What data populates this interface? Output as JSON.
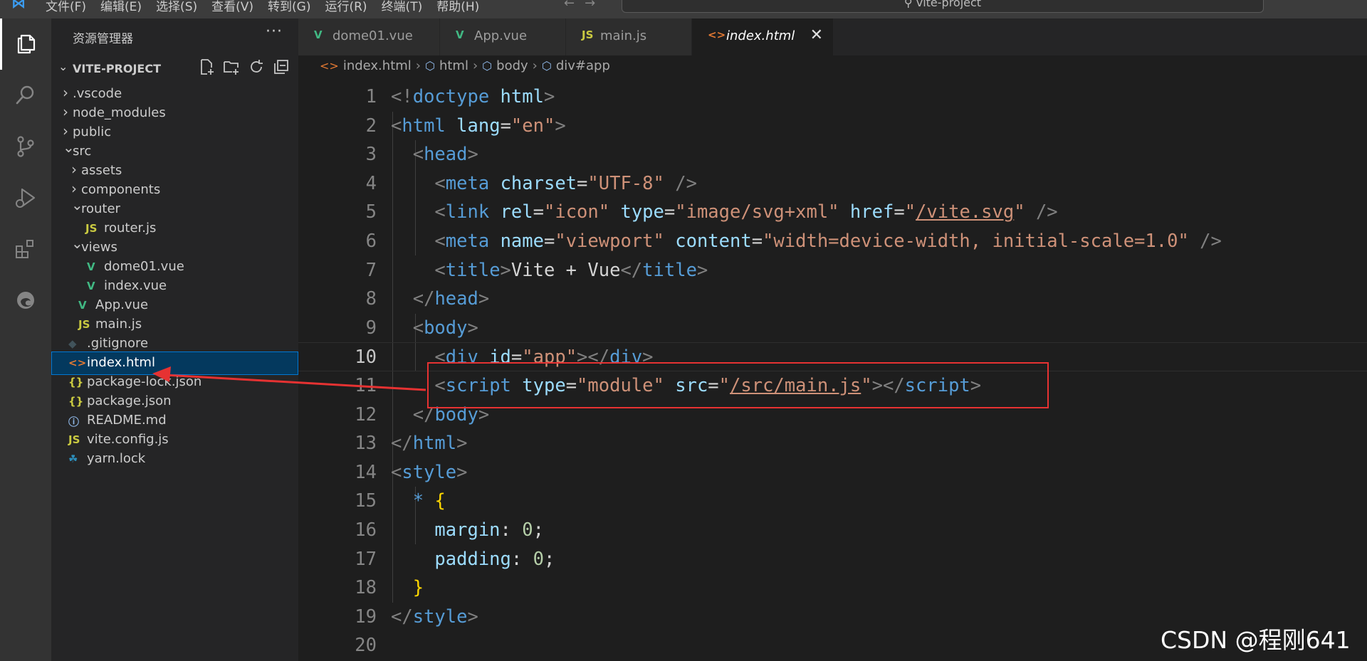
{
  "titlebar": {
    "menu": [
      "文件(F)",
      "编辑(E)",
      "选择(S)",
      "查看(V)",
      "转到(G)",
      "运行(R)",
      "终端(T)",
      "帮助(H)"
    ],
    "search_text": "vite-project"
  },
  "activity_bar": [
    "explorer-icon",
    "search-icon",
    "source-control-icon",
    "run-debug-icon",
    "extensions-icon",
    "edge-tools-icon"
  ],
  "sidebar": {
    "title": "资源管理器",
    "more": "···",
    "project_name": "VITE-PROJECT",
    "tree": [
      {
        "label": ".vscode",
        "type": "folder",
        "expanded": false
      },
      {
        "label": "node_modules",
        "type": "folder",
        "expanded": false
      },
      {
        "label": "public",
        "type": "folder",
        "expanded": false
      },
      {
        "label": "src",
        "type": "folder",
        "expanded": true
      },
      {
        "label": "assets",
        "type": "folder",
        "expanded": false
      },
      {
        "label": "components",
        "type": "folder",
        "expanded": false
      },
      {
        "label": "router",
        "type": "folder",
        "expanded": true
      },
      {
        "label": "router.js",
        "type": "js"
      },
      {
        "label": "views",
        "type": "folder",
        "expanded": true
      },
      {
        "label": "dome01.vue",
        "type": "vue"
      },
      {
        "label": "index.vue",
        "type": "vue"
      },
      {
        "label": "App.vue",
        "type": "vue"
      },
      {
        "label": "main.js",
        "type": "js"
      },
      {
        "label": ".gitignore",
        "type": "git"
      },
      {
        "label": "index.html",
        "type": "html",
        "selected": true
      },
      {
        "label": "package-lock.json",
        "type": "json"
      },
      {
        "label": "package.json",
        "type": "json"
      },
      {
        "label": "README.md",
        "type": "info"
      },
      {
        "label": "vite.config.js",
        "type": "js"
      },
      {
        "label": "yarn.lock",
        "type": "yarn"
      }
    ]
  },
  "tabs": [
    {
      "label": "dome01.vue",
      "type": "vue"
    },
    {
      "label": "App.vue",
      "type": "vue"
    },
    {
      "label": "main.js",
      "type": "js"
    },
    {
      "label": "index.html",
      "type": "html",
      "active": true
    }
  ],
  "breadcrumb": [
    "index.html",
    "html",
    "body",
    "div#app"
  ],
  "editor": {
    "current_line": 10,
    "lines": [
      "1",
      "2",
      "3",
      "4",
      "5",
      "6",
      "7",
      "8",
      "9",
      "10",
      "11",
      "12",
      "13",
      "14",
      "15",
      "16",
      "17",
      "18",
      "19",
      "20"
    ]
  },
  "icons": {
    "js": "JS",
    "html": "<>",
    "json": "{}",
    "vue": "V",
    "info": "ⓘ",
    "git": "◆",
    "yarn": "☘",
    "close": "✕",
    "chevron_right": "›",
    "chevron_down": "⌄"
  },
  "colors": {
    "vue": "#41b883",
    "js": "#cbcb41",
    "html": "#e37933",
    "json": "#cbcb41",
    "info": "#8fb8e8",
    "git": "#41535b",
    "yarn": "#2c8ebb",
    "annotation": "#e63232"
  },
  "watermark": "CSDN @程刚641"
}
